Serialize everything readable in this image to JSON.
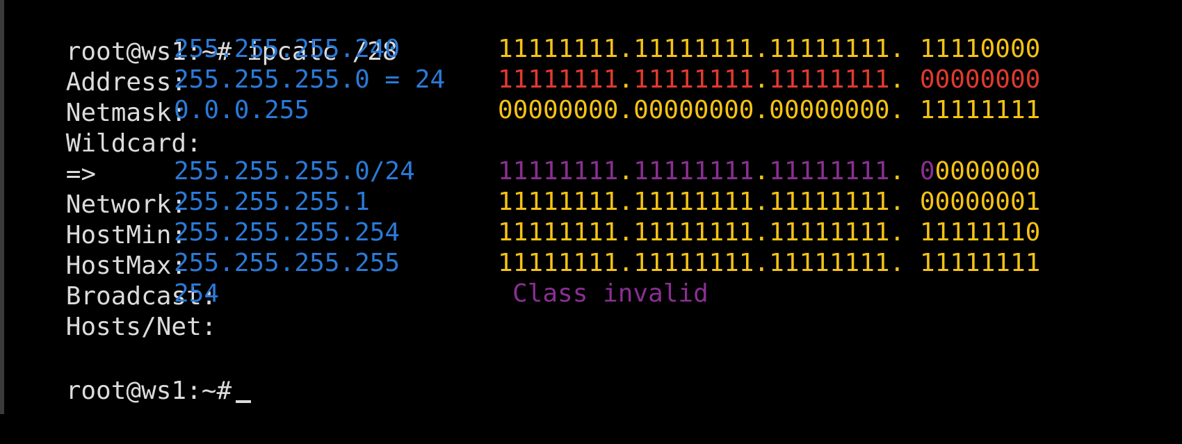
{
  "colors": {
    "background": "#000000",
    "text": "#dcdcdc",
    "value": "#2a7ad8",
    "binary": "#f5c314",
    "netmask_binary": "#e23a2e",
    "network_binary": "#8a2f92",
    "class_info": "#8a2f92"
  },
  "prompt": "root@ws1:~#",
  "command": "ipcalc /28",
  "rows": [
    {
      "label": "Address:",
      "value": "255.255.255.240",
      "binary": {
        "o1": "11111111",
        "o2": "11111111",
        "o3": "11111111",
        "host_bit": "",
        "host_rest": "11110000"
      }
    },
    {
      "label": "Netmask:",
      "value": "255.255.255.0 = 24",
      "binary": {
        "o1": "11111111",
        "o2": "11111111",
        "o3": "11111111",
        "host_bit": "",
        "host_rest": "00000000"
      }
    },
    {
      "label": "Wildcard:",
      "value": "0.0.0.255",
      "binary": {
        "o1": "00000000",
        "o2": "00000000",
        "o3": "00000000",
        "host_bit": "",
        "host_rest": "11111111"
      }
    },
    {
      "label": "=>"
    },
    {
      "label": "Network:",
      "value": "255.255.255.0/24",
      "binary": {
        "o1": "11111111",
        "o2": "11111111",
        "o3": "11111111",
        "host_bit": "0",
        "host_rest": "0000000"
      }
    },
    {
      "label": "HostMin:",
      "value": "255.255.255.1",
      "binary": {
        "o1": "11111111",
        "o2": "11111111",
        "o3": "11111111",
        "host_bit": "",
        "host_rest": "00000001"
      }
    },
    {
      "label": "HostMax:",
      "value": "255.255.255.254",
      "binary": {
        "o1": "11111111",
        "o2": "11111111",
        "o3": "11111111",
        "host_bit": "",
        "host_rest": "11111110"
      }
    },
    {
      "label": "Broadcast:",
      "value": "255.255.255.255",
      "binary": {
        "o1": "11111111",
        "o2": "11111111",
        "o3": "11111111",
        "host_bit": "",
        "host_rest": "11111111"
      }
    },
    {
      "label": "Hosts/Net:",
      "value": "254",
      "class_info": "Class invalid"
    }
  ],
  "separators": {
    "dot": ".",
    "dot_space": ". "
  }
}
